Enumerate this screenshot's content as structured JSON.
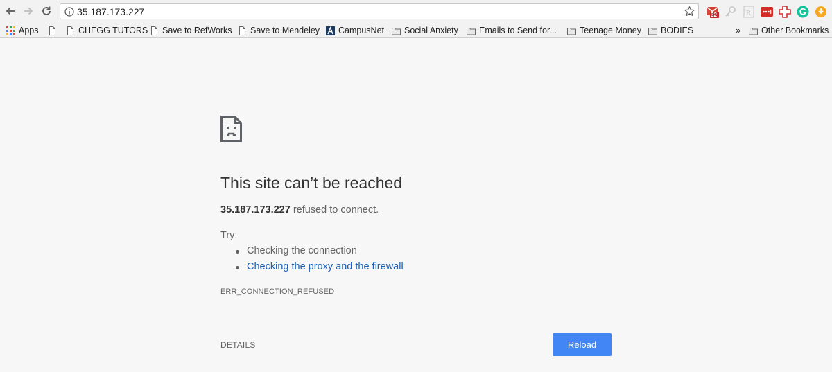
{
  "browser": {
    "url": "35.187.173.227",
    "extensions": [
      {
        "name": "gmail-checker",
        "badge": "32",
        "color": "#d44638"
      },
      {
        "name": "key-extension",
        "color": "#bbbbbb"
      },
      {
        "name": "readcube-extension",
        "color": "#bbbbbb"
      },
      {
        "name": "lastpass-extension",
        "color": "#d32d27"
      },
      {
        "name": "plus-extension",
        "color": "#d03030"
      },
      {
        "name": "grammarly-extension",
        "color": "#15c39a"
      },
      {
        "name": "honey-extension",
        "color": "#f5a623"
      }
    ]
  },
  "bookmarks": {
    "apps_label": "Apps",
    "items": [
      {
        "label": "",
        "icon": "page-icon"
      },
      {
        "label": "CHEGG TUTORS",
        "icon": "page-icon"
      },
      {
        "label": "Save to RefWorks",
        "icon": "page-icon"
      },
      {
        "label": "Save to Mendeley",
        "icon": "page-icon"
      },
      {
        "label": "CampusNet",
        "icon": "campusnet-icon"
      },
      {
        "label": "Social Anxiety",
        "icon": "folder-icon"
      },
      {
        "label": "Emails to Send for...",
        "icon": "folder-icon"
      },
      {
        "label": "Teenage Money",
        "icon": "folder-icon"
      },
      {
        "label": "BODIES",
        "icon": "folder-icon"
      }
    ],
    "overflow_label": "»",
    "other_label": "Other Bookmarks"
  },
  "error": {
    "title": "This site can’t be reached",
    "host": "35.187.173.227",
    "message_suffix": " refused to connect.",
    "try_label": "Try:",
    "suggestion_1": "Checking the connection",
    "suggestion_2": "Checking the proxy and the firewall",
    "code": "ERR_CONNECTION_REFUSED",
    "details_label": "DETAILS",
    "reload_label": "Reload"
  }
}
